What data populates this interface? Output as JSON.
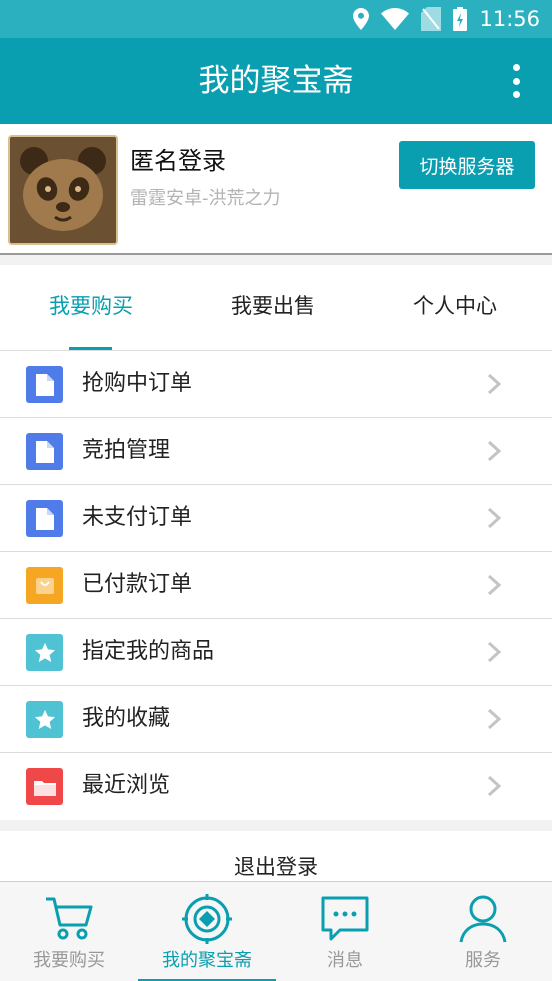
{
  "status_bar": {
    "time": "11:56",
    "icons": [
      "location-icon",
      "wifi-icon",
      "sim-icon",
      "battery-icon"
    ]
  },
  "app_bar": {
    "title": "我的聚宝斋",
    "more_icon": "more-vertical-icon"
  },
  "profile": {
    "name": "匿名登录",
    "server": "雷霆安卓-洪荒之力",
    "switch_button": "切换服务器",
    "avatar_icon": "panda-avatar"
  },
  "tabs": [
    {
      "label": "我要购买",
      "active": true
    },
    {
      "label": "我要出售",
      "active": false
    },
    {
      "label": "个人中心",
      "active": false
    }
  ],
  "menu": [
    {
      "label": "抢购中订单",
      "icon": "document-icon",
      "color": "#4f7ce8"
    },
    {
      "label": "竞拍管理",
      "icon": "document-icon",
      "color": "#4f7ce8"
    },
    {
      "label": "未支付订单",
      "icon": "document-icon",
      "color": "#4f7ce8"
    },
    {
      "label": "已付款订单",
      "icon": "bag-icon",
      "color": "#f5a623"
    },
    {
      "label": "指定我的商品",
      "icon": "star-icon",
      "color": "#4fc3d4"
    },
    {
      "label": "我的收藏",
      "icon": "star-icon",
      "color": "#4fc3d4"
    },
    {
      "label": "最近浏览",
      "icon": "folder-icon",
      "color": "#f04848"
    }
  ],
  "logout": {
    "label": "退出登录"
  },
  "bottom_nav": [
    {
      "label": "我要购买",
      "icon": "cart-icon",
      "active": false
    },
    {
      "label": "我的聚宝斋",
      "icon": "treasure-icon",
      "active": true
    },
    {
      "label": "消息",
      "icon": "message-icon",
      "active": false
    },
    {
      "label": "服务",
      "icon": "person-icon",
      "active": false
    }
  ],
  "colors": {
    "primary": "#0a9fb0",
    "status_bar": "#2bb0c0"
  }
}
